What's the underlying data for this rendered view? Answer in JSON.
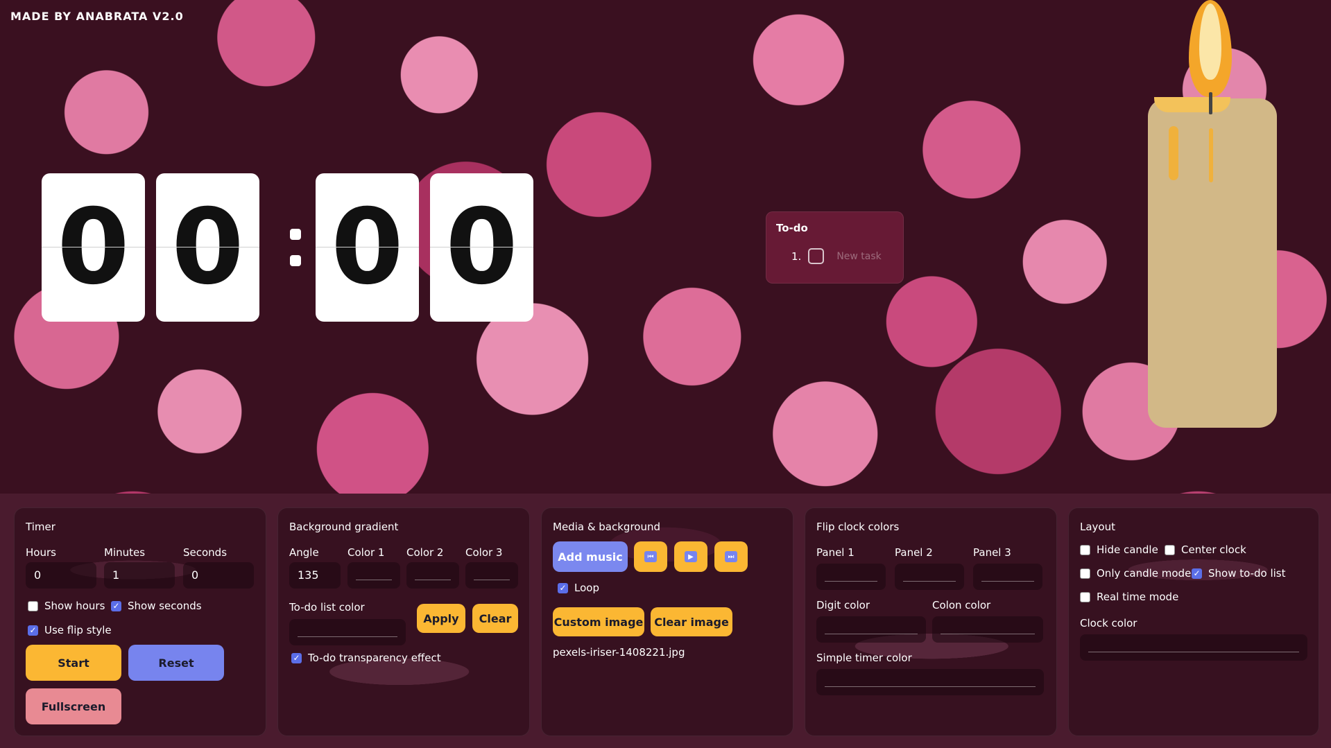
{
  "brand": "MADE BY ANABRATA V2.0",
  "clock": {
    "digits": [
      "0",
      "0",
      "0",
      "0"
    ]
  },
  "todo": {
    "title": "To-do",
    "items": [
      {
        "number": "1.",
        "placeholder": "New task"
      }
    ]
  },
  "timer": {
    "title": "Timer",
    "hours_label": "Hours",
    "minutes_label": "Minutes",
    "seconds_label": "Seconds",
    "hours_value": "0",
    "minutes_value": "1",
    "seconds_value": "0",
    "show_hours": {
      "label": "Show hours",
      "checked": false
    },
    "show_seconds": {
      "label": "Show seconds",
      "checked": true
    },
    "use_flip": {
      "label": "Use flip style",
      "checked": true
    },
    "start_label": "Start",
    "reset_label": "Reset",
    "fullscreen_label": "Fullscreen"
  },
  "background_gradient": {
    "title": "Background gradient",
    "angle_label": "Angle",
    "angle_value": "135",
    "color1_label": "Color 1",
    "color2_label": "Color 2",
    "color3_label": "Color 3",
    "todo_color_label": "To-do list color",
    "apply_label": "Apply",
    "clear_label": "Clear",
    "transparency": {
      "label": "To-do transparency effect",
      "checked": true
    }
  },
  "media": {
    "title": "Media & background",
    "add_music_label": "Add music",
    "prev_icon": "skip-back-icon",
    "play_icon": "play-icon",
    "next_icon": "skip-forward-icon",
    "loop": {
      "label": "Loop",
      "checked": true
    },
    "custom_image_label": "Custom image",
    "clear_image_label": "Clear image",
    "file_name": "pexels-iriser-1408221.jpg"
  },
  "flip_colors": {
    "title": "Flip clock colors",
    "panel1_label": "Panel 1",
    "panel2_label": "Panel 2",
    "panel3_label": "Panel 3",
    "digit_color_label": "Digit color",
    "colon_color_label": "Colon color",
    "simple_timer_color_label": "Simple timer color"
  },
  "layout": {
    "title": "Layout",
    "hide_candle": {
      "label": "Hide candle",
      "checked": false
    },
    "center_clock": {
      "label": "Center clock",
      "checked": false
    },
    "only_candle": {
      "label": "Only candle mode",
      "checked": false
    },
    "show_todo": {
      "label": "Show to-do list",
      "checked": true
    },
    "real_time": {
      "label": "Real time mode",
      "checked": false
    },
    "clock_color_label": "Clock color"
  },
  "colors": {
    "accent_yellow": "#fbb733",
    "accent_blue": "#7784ee",
    "candle": "#d2b887"
  }
}
